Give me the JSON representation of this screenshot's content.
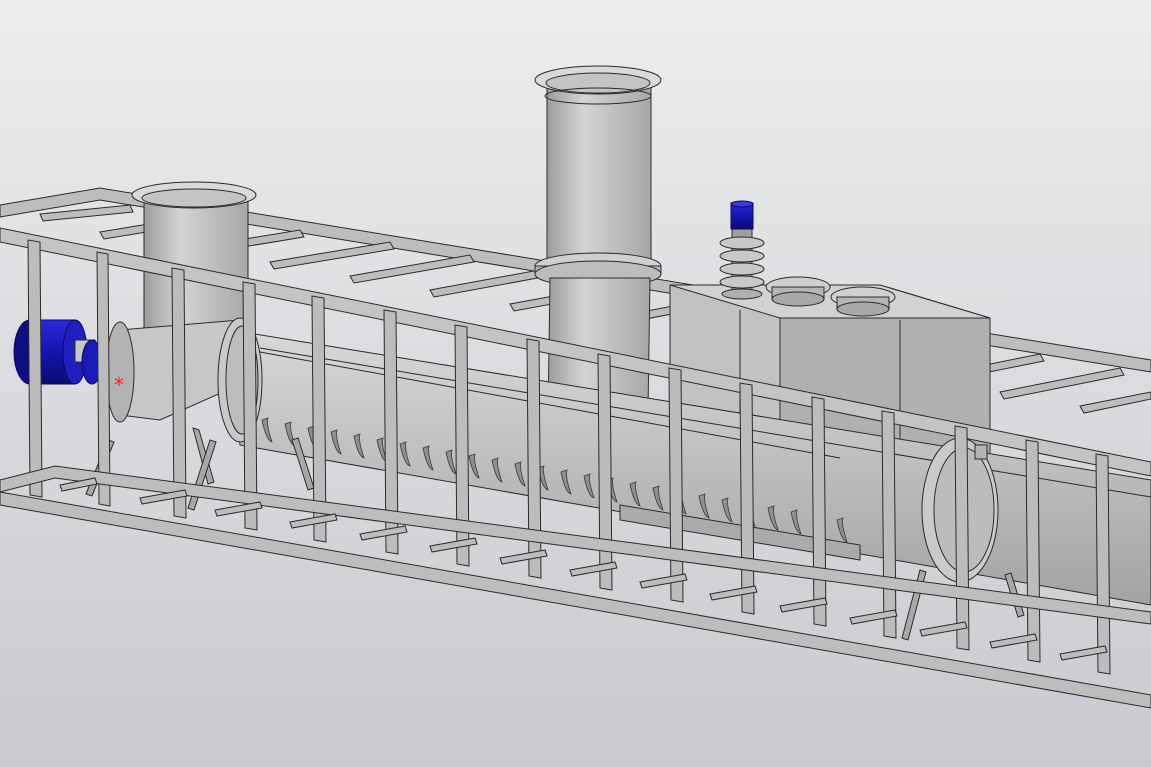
{
  "viewport": {
    "background_top": "#c9cacf",
    "background_bottom": "#ecedee"
  },
  "model": {
    "metal_color": "#b9b9b9",
    "metal_light": "#d6d6d6",
    "metal_dark": "#8c8c8c",
    "edge_color": "#2b2b2b",
    "motor_color": "#1515b0",
    "origin_marker_color": "#ff2020",
    "origin_marker_glyph": "*"
  }
}
